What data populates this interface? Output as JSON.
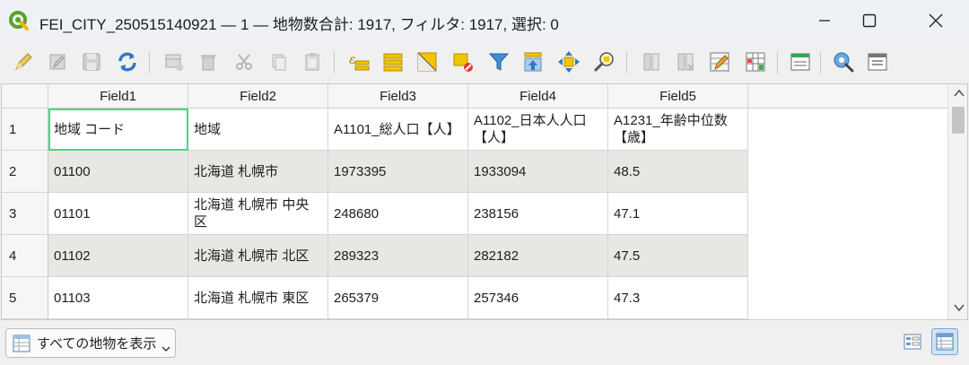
{
  "window": {
    "title": "FEI_CITY_250515140921 — 1 — 地物数合計: 1917, フィルタ: 1917, 選択: 0",
    "app_icon": "qgis-icon",
    "controls": [
      "minimize-icon",
      "maximize-icon",
      "close-icon"
    ]
  },
  "toolbar": {
    "icons": [
      "pencil-edit-icon",
      "multi-edit-icon",
      "save-edits-icon",
      "reload-icon",
      "add-feature-icon",
      "delete-feature-icon",
      "cut-icon",
      "copy-icon",
      "paste-icon",
      "select-by-expression-icon",
      "select-all-icon",
      "invert-selection-icon",
      "deselect-all-icon",
      "filter-icon",
      "move-selection-top-icon",
      "pan-to-selection-icon",
      "zoom-to-selection-icon",
      "new-field-icon",
      "delete-field-icon",
      "field-calculator-icon",
      "conditional-format-icon",
      "dock-table-icon",
      "actions-icon",
      "form-view-icon"
    ]
  },
  "table": {
    "columns": [
      "Field1",
      "Field2",
      "Field3",
      "Field4",
      "Field5"
    ],
    "rows": [
      {
        "num": "1",
        "cells": [
          "地域 コード",
          "地域",
          "A1101_総人口【人】",
          "A1102_日本人人口【人】",
          "A1231_年齢中位数【歳】"
        ]
      },
      {
        "num": "2",
        "cells": [
          "01100",
          "北海道 札幌市",
          "1973395",
          "1933094",
          "48.5"
        ]
      },
      {
        "num": "3",
        "cells": [
          "01101",
          "北海道 札幌市 中央区",
          "248680",
          "238156",
          "47.1"
        ]
      },
      {
        "num": "4",
        "cells": [
          "01102",
          "北海道 札幌市 北区",
          "289323",
          "282182",
          "47.5"
        ]
      },
      {
        "num": "5",
        "cells": [
          "01103",
          "北海道 札幌市 東区",
          "265379",
          "257346",
          "47.3"
        ]
      }
    ]
  },
  "bottom": {
    "filter_label": "すべての地物を表示",
    "filter_icon": "table-filter-icon",
    "form_view_icon": "form-view-icon",
    "table_view_icon": "table-view-icon"
  },
  "colors": {
    "selected_cell_border": "#3ddc84",
    "alt_row": "#e9e7e4",
    "active_view_bg": "#cfe2f6"
  }
}
